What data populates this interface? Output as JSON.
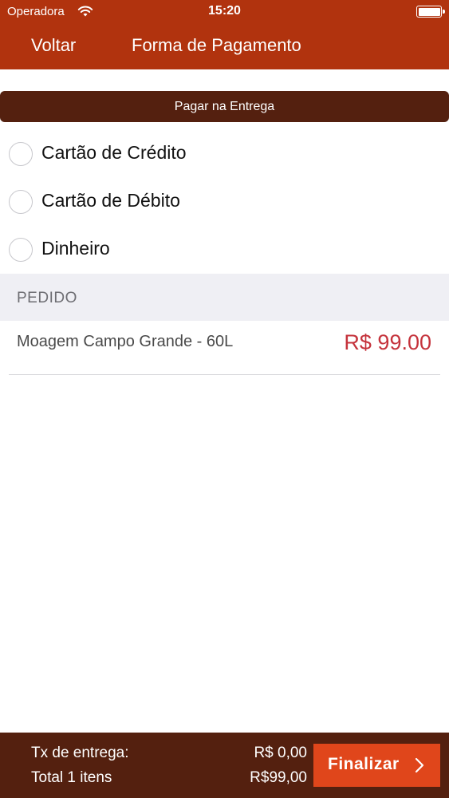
{
  "status_bar": {
    "carrier": "Operadora",
    "time": "15:20"
  },
  "nav": {
    "back_label": "Voltar",
    "title": "Forma de Pagamento"
  },
  "banner": "Pagar na Entrega",
  "payment_options": [
    {
      "label": "Cartão de Crédito",
      "selected": false
    },
    {
      "label": "Cartão de Débito",
      "selected": false
    },
    {
      "label": "Dinheiro",
      "selected": false
    }
  ],
  "section_title": "PEDIDO",
  "order_items": [
    {
      "name": "Moagem Campo Grande - 60L",
      "price": "R$ 99.00"
    }
  ],
  "footer": {
    "fee_label": "Tx de entrega:",
    "fee_value": "R$ 0,00",
    "total_label": "Total  1 itens",
    "total_value": "R$99,00",
    "finalize_label": "Finalizar"
  },
  "colors": {
    "nav_background": "#b1330e",
    "banner_background": "#54200f",
    "price_color": "#c5333c",
    "finalize_background": "#e0461b"
  },
  "icons": [
    "wifi-icon",
    "battery-icon",
    "radio-icon",
    "chevron-right-icon"
  ]
}
